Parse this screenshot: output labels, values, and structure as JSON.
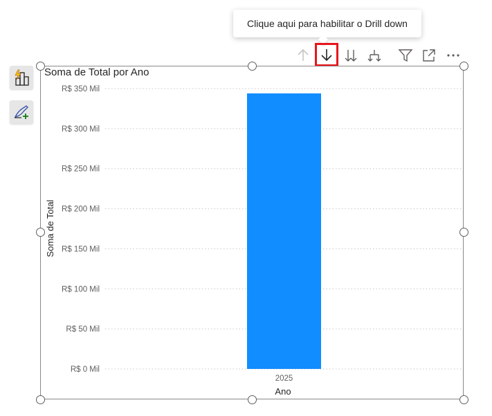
{
  "tooltip": {
    "text": "Clique aqui para habilitar o Drill down"
  },
  "visual_header": {
    "icons": [
      "arrow-up-icon",
      "arrow-down-icon",
      "double-arrow-down-icon",
      "expand-hierarchy-icon",
      "filter-icon",
      "focus-mode-icon",
      "more-options-icon"
    ],
    "highlight_color": "#e8141b"
  },
  "side_buttons": [
    "quick-measure-icon",
    "format-brush-icon"
  ],
  "chart_data": {
    "type": "bar",
    "title": "Soma de Total por Ano",
    "xlabel": "Ano",
    "ylabel": "Soma de Total",
    "categories": [
      "2025"
    ],
    "values": [
      344000
    ],
    "ylim": [
      0,
      350000
    ],
    "yticks": [
      0,
      50000,
      100000,
      150000,
      200000,
      250000,
      300000,
      350000
    ],
    "ytick_labels": [
      "R$ 0 Mil",
      "R$ 50 Mil",
      "R$ 100 Mil",
      "R$ 150 Mil",
      "R$ 200 Mil",
      "R$ 250 Mil",
      "R$ 300 Mil",
      "R$ 350 Mil"
    ],
    "bar_color": "#118dff",
    "grid": true
  }
}
